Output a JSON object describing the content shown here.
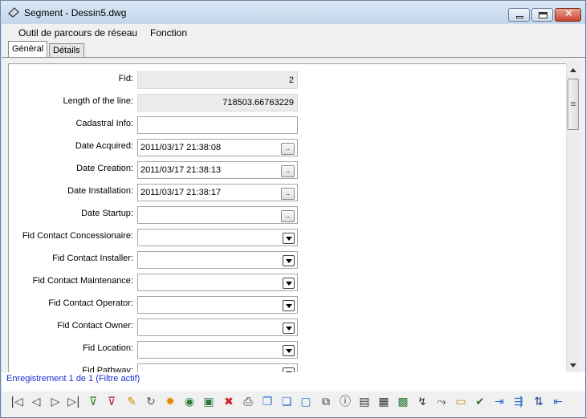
{
  "window": {
    "title": "Segment - Dessin5.dwg",
    "close_glyph": "✕"
  },
  "menu": [
    "Outil de parcours de réseau",
    "Fonction"
  ],
  "tabs": [
    "Général",
    "Détails"
  ],
  "fields": [
    {
      "label": "Fid:",
      "value": "2",
      "kind": "readonly"
    },
    {
      "label": "Length of the line:",
      "value": "718503.66763229",
      "kind": "readonly"
    },
    {
      "label": "Cadastral Info:",
      "value": "",
      "kind": "text"
    },
    {
      "label": "Date Acquired:",
      "value": "2011/03/17 21:38:08",
      "kind": "date"
    },
    {
      "label": "Date Creation:",
      "value": "2011/03/17 21:38:13",
      "kind": "date"
    },
    {
      "label": "Date Installation:",
      "value": "2011/03/17 21:38:17",
      "kind": "date"
    },
    {
      "label": "Date Startup:",
      "value": "",
      "kind": "date"
    },
    {
      "label": "Fid Contact Concessionaire:",
      "value": "",
      "kind": "dropdown"
    },
    {
      "label": "Fid Contact Installer:",
      "value": "",
      "kind": "dropdown"
    },
    {
      "label": "Fid Contact Maintenance:",
      "value": "",
      "kind": "dropdown"
    },
    {
      "label": "Fid Contact Operator:",
      "value": "",
      "kind": "dropdown"
    },
    {
      "label": "Fid Contact Owner:",
      "value": "",
      "kind": "dropdown"
    },
    {
      "label": "Fid Location:",
      "value": "",
      "kind": "dropdown"
    },
    {
      "label": "Fid Pathway:",
      "value": "",
      "kind": "dropdown"
    }
  ],
  "date_button_label": "..",
  "status": "Enregistrement 1 de 1 (Filtre actif)",
  "toolbar": [
    {
      "icon": "first-record-icon",
      "glyph": "|◁",
      "color": "#333333"
    },
    {
      "icon": "previous-record-icon",
      "glyph": "◁",
      "color": "#333333"
    },
    {
      "icon": "next-record-icon",
      "glyph": "▷",
      "color": "#333333"
    },
    {
      "icon": "last-record-icon",
      "glyph": "▷|",
      "color": "#333333"
    },
    {
      "icon": "filter-add-icon",
      "glyph": "⊽",
      "color": "#2a7a2a"
    },
    {
      "icon": "filter-remove-icon",
      "glyph": "⊽",
      "color": "#b02020"
    },
    {
      "icon": "edit-pencil-icon",
      "glyph": "✎",
      "color": "#c89000"
    },
    {
      "icon": "refresh-icon",
      "glyph": "↻",
      "color": "#555555"
    },
    {
      "icon": "new-record-icon",
      "glyph": "✸",
      "color": "#e08a00"
    },
    {
      "icon": "globe-icon",
      "glyph": "◉",
      "color": "#2d7a3a"
    },
    {
      "icon": "select-icon",
      "glyph": "▣",
      "color": "#2d7a3a"
    },
    {
      "icon": "delete-icon",
      "glyph": "✖",
      "color": "#d02020"
    },
    {
      "icon": "print-icon",
      "glyph": "⎙",
      "color": "#333333"
    },
    {
      "icon": "copy-icon",
      "glyph": "❐",
      "color": "#2a6fd0"
    },
    {
      "icon": "duplicate-icon",
      "glyph": "❏",
      "color": "#2a6fd0"
    },
    {
      "icon": "zoom-to-icon",
      "glyph": "▢",
      "color": "#2a6fd0"
    },
    {
      "icon": "link-icon",
      "glyph": "⧉",
      "color": "#333333"
    },
    {
      "icon": "info-icon",
      "glyph": "ⓘ",
      "color": "#333333"
    },
    {
      "icon": "document-icon",
      "glyph": "▤",
      "color": "#333333"
    },
    {
      "icon": "report-icon",
      "glyph": "▦",
      "color": "#333333"
    },
    {
      "icon": "export-icon",
      "glyph": "▩",
      "color": "#2d7a3a"
    },
    {
      "icon": "trace-icon",
      "glyph": "↯",
      "color": "#333333"
    },
    {
      "icon": "network-trace-icon",
      "glyph": "⤳",
      "color": "#333333"
    },
    {
      "icon": "form-icon",
      "glyph": "▭",
      "color": "#c89000"
    },
    {
      "icon": "check-icon",
      "glyph": "✔",
      "color": "#2d7a3a"
    },
    {
      "icon": "connect-icon",
      "glyph": "⇥",
      "color": "#2a6fd0"
    },
    {
      "icon": "split-icon",
      "glyph": "⇶",
      "color": "#2a6fd0"
    },
    {
      "icon": "sort-icon",
      "glyph": "⇅",
      "color": "#1c3f8c"
    },
    {
      "icon": "exit-icon",
      "glyph": "⇤",
      "color": "#2a6fd0"
    }
  ]
}
